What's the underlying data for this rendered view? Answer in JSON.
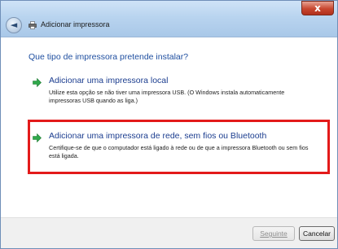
{
  "window": {
    "title": "Adicionar impressora",
    "close_label": "x",
    "back_label": "◄"
  },
  "main": {
    "heading": "Que tipo de impressora pretende instalar?",
    "options": [
      {
        "title": "Adicionar uma impressora local",
        "description": "Utilize esta opção se não tiver uma impressora USB. (O Windows instala automaticamente impressoras USB quando as liga.)",
        "highlighted": false
      },
      {
        "title": "Adicionar uma impressora de rede, sem fios ou Bluetooth",
        "description": "Certifique-se de que o computador está ligado à rede ou de que a impressora Bluetooth ou sem fios está ligada.",
        "highlighted": true
      }
    ]
  },
  "footer": {
    "next_label": "Seguinte",
    "cancel_label": "Cancelar"
  },
  "colors": {
    "heading_blue": "#1f4fa0",
    "option_blue": "#1b3d8f",
    "arrow_green": "#2fa84a",
    "highlight_red": "#e31a1a"
  },
  "icons": [
    "close-icon",
    "back-arrow-icon",
    "printer-icon",
    "green-arrow-icon"
  ]
}
